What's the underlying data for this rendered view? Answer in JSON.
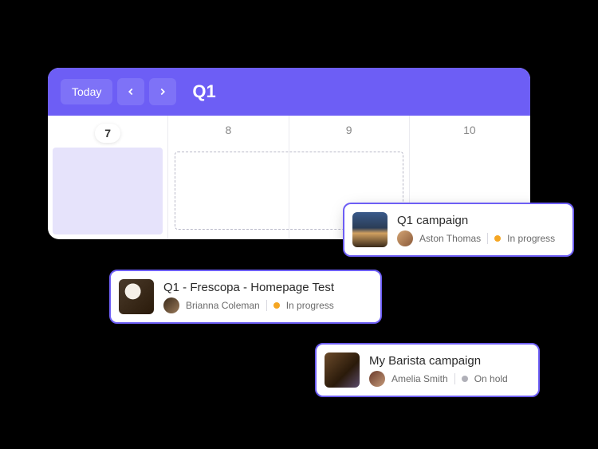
{
  "calendar": {
    "today_label": "Today",
    "title": "Q1",
    "days": [
      "7",
      "8",
      "9",
      "10"
    ],
    "selected_day_index": 0
  },
  "cards": [
    {
      "title": "Q1 campaign",
      "owner": "Aston Thomas",
      "status_label": "In progress",
      "status_color": "#f5a623"
    },
    {
      "title": "Q1 - Frescopa - Homepage Test",
      "owner": "Brianna Coleman",
      "status_label": "In progress",
      "status_color": "#f5a623"
    },
    {
      "title": "My Barista campaign",
      "owner": "Amelia Smith",
      "status_label": "On hold",
      "status_color": "#b0b0b8"
    }
  ]
}
